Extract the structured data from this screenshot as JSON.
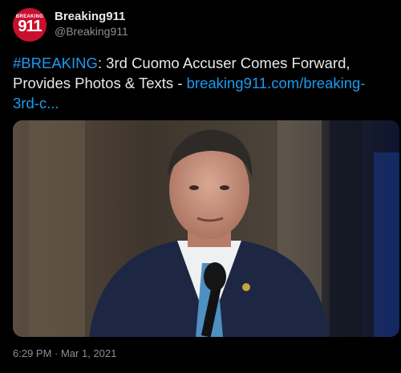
{
  "account": {
    "name": "Breaking911",
    "handle": "@Breaking911",
    "avatar_small_text": "BREAKING",
    "avatar_big_text": "911",
    "avatar_color": "#c8102e"
  },
  "tweet": {
    "hashtag": "#BREAKING",
    "text_body": ": 3rd Cuomo Accuser Comes Forward, Provides Photos & Texts - ",
    "link_text": "breaking911.com/breaking-3rd-c...",
    "timestamp": "6:29 PM · Mar 1, 2021"
  },
  "colors": {
    "background": "#000000",
    "link": "#1d9bf0",
    "text": "#e7e9ea",
    "muted": "#8b9095"
  }
}
